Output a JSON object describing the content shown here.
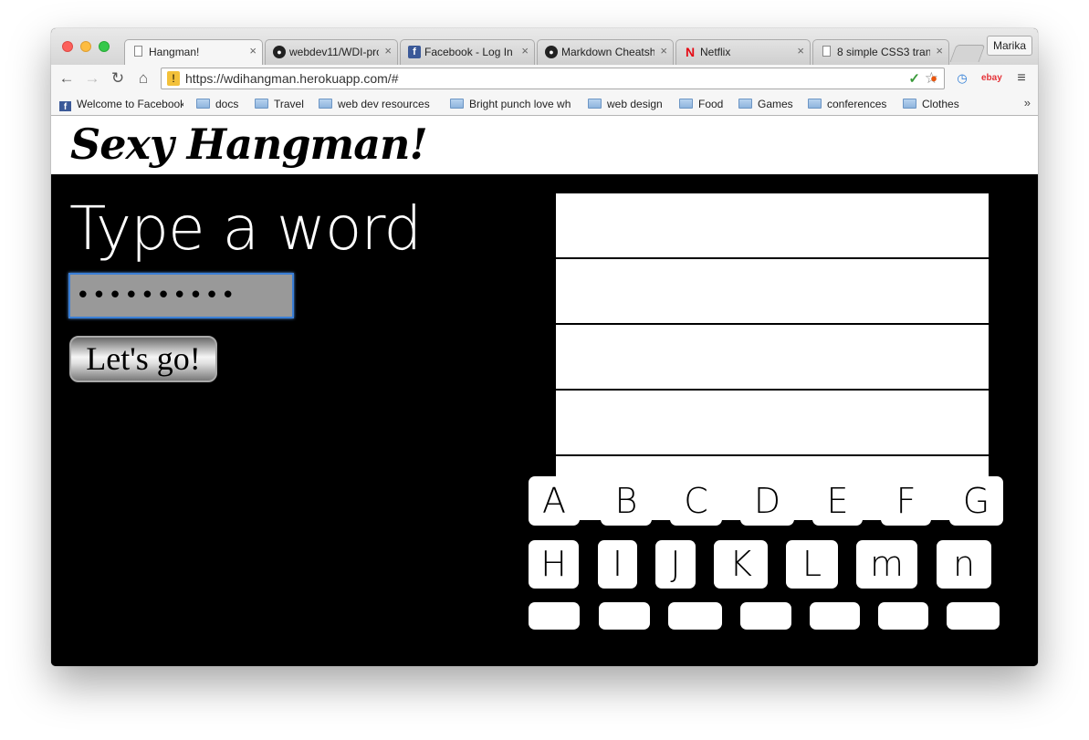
{
  "browser": {
    "tabs": [
      {
        "title": "Hangman!",
        "favicon": "document-icon"
      },
      {
        "title": "webdev11/WDI-pro",
        "favicon": "github-icon"
      },
      {
        "title": "Facebook - Log In",
        "favicon": "facebook-icon"
      },
      {
        "title": "Markdown Cheatsh",
        "favicon": "github-icon"
      },
      {
        "title": "Netflix",
        "favicon": "netflix-icon"
      },
      {
        "title": "8 simple CSS3 tran",
        "favicon": "document-icon"
      }
    ],
    "profile_name": "Marika",
    "url": "https://wdihangman.herokuapp.com/#",
    "bookmarks": [
      "Welcome to Facebook",
      "docs",
      "Travel",
      "web dev resources",
      "Bright punch love wh",
      "web design",
      "Food",
      "Games",
      "conferences",
      "Clothes"
    ],
    "bookmarks_more": "»",
    "icons": {
      "back": "←",
      "forward": "→",
      "reload": "↻",
      "home": "⌂",
      "star": "☆",
      "close": "×"
    }
  },
  "page": {
    "title": "Sexy Hangman!",
    "prompt": "Type a word",
    "word_input_value": "••••••••••",
    "submit_label": "Let's go!",
    "letter_rows": [
      [
        "A",
        "B",
        "C",
        "D",
        "E",
        "F",
        "G"
      ],
      [
        "H",
        "I",
        "J",
        "K",
        "L",
        "m",
        "n"
      ],
      [
        "",
        "",
        "",
        "",
        "",
        "",
        ""
      ]
    ]
  },
  "colors": {
    "page_background": "#000000",
    "header_background": "#ffffff",
    "input_background": "#999999",
    "input_focus_border": "#3b7fd6",
    "key_background": "#ffffff"
  }
}
